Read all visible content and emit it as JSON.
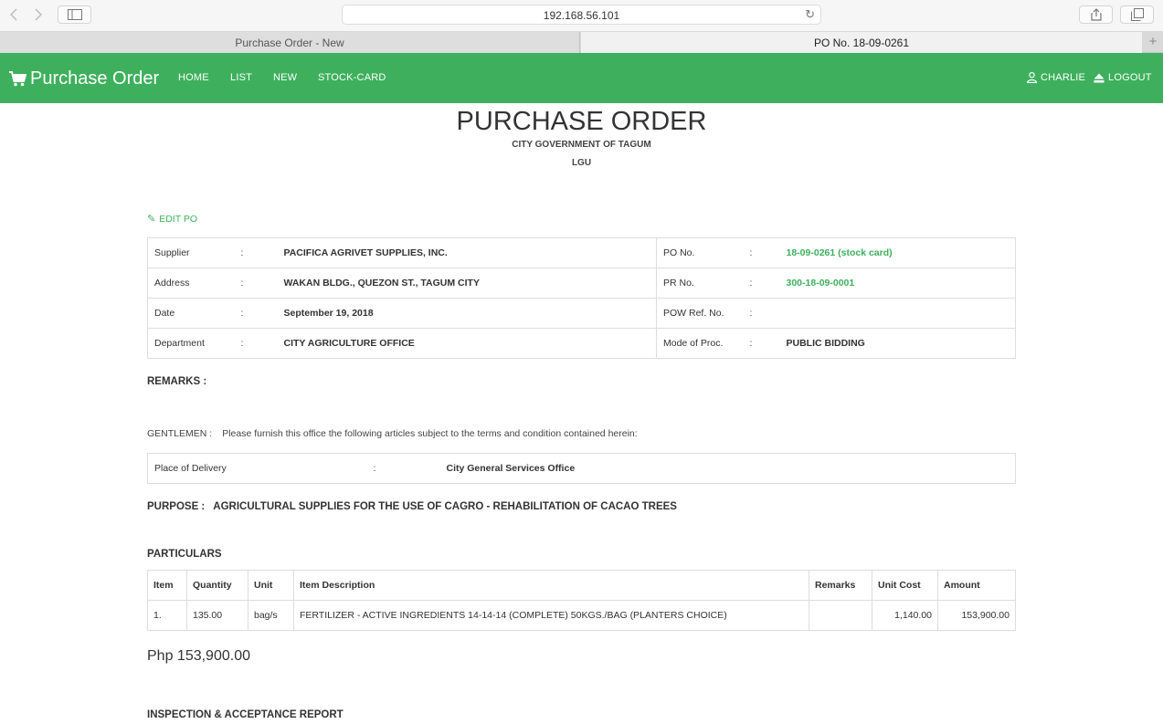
{
  "browser": {
    "address": "192.168.56.101",
    "tabs": [
      {
        "label": "Purchase Order - New",
        "active": false
      },
      {
        "label": "PO No. 18-09-0261",
        "active": true
      }
    ]
  },
  "navbar": {
    "brand": "Purchase Order",
    "links": [
      "HOME",
      "LIST",
      "NEW",
      "STOCK-CARD"
    ],
    "user": "CHARLIE",
    "logout": "LOGOUT",
    "color": "#3eb05d"
  },
  "header": {
    "title": "PURCHASE ORDER",
    "subtitle1": "CITY GOVERNMENT OF TAGUM",
    "subtitle2": "LGU"
  },
  "edit_po": "EDIT PO",
  "info": {
    "supplier_label": "Supplier",
    "supplier": "PACIFICA AGRIVET SUPPLIES, INC.",
    "address_label": "Address",
    "address": "WAKAN BLDG., QUEZON ST., TAGUM CITY",
    "date_label": "Date",
    "date": "September 19, 2018",
    "department_label": "Department",
    "department": "CITY AGRICULTURE OFFICE",
    "po_no_label": "PO No.",
    "po_no": "18-09-0261 (stock card)",
    "pr_no_label": "PR No.",
    "pr_no": "300-18-09-0001",
    "pow_label": "POW Ref. No.",
    "pow": "",
    "mode_label": "Mode of Proc.",
    "mode": "PUBLIC BIDDING",
    "sep": ":"
  },
  "remarks_label": "REMARKS :",
  "gentlemen": {
    "label": "GENTLEMEN :",
    "text": "Please furnish this office the following articles subject to the terms and condition contained herein:"
  },
  "delivery": {
    "label": "Place of Delivery",
    "sep": ":",
    "value": "City General Services Office"
  },
  "purpose": {
    "label": "PURPOSE :",
    "text": "AGRICULTURAL SUPPLIES FOR THE USE OF CAGRO - REHABILITATION OF CACAO TREES"
  },
  "particulars": {
    "heading": "PARTICULARS",
    "columns": [
      "Item",
      "Quantity",
      "Unit",
      "Item Description",
      "Remarks",
      "Unit Cost",
      "Amount"
    ],
    "rows": [
      {
        "item": "1.",
        "quantity": "135.00",
        "unit": "bag/s",
        "description": "FERTILIZER - ACTIVE INGREDIENTS 14-14-14 (COMPLETE) 50KGS./BAG (PLANTERS CHOICE)",
        "remarks": "",
        "unit_cost": "1,140.00",
        "amount": "153,900.00"
      }
    ]
  },
  "total": "Php 153,900.00",
  "inspection_heading": "INSPECTION & ACCEPTANCE REPORT"
}
